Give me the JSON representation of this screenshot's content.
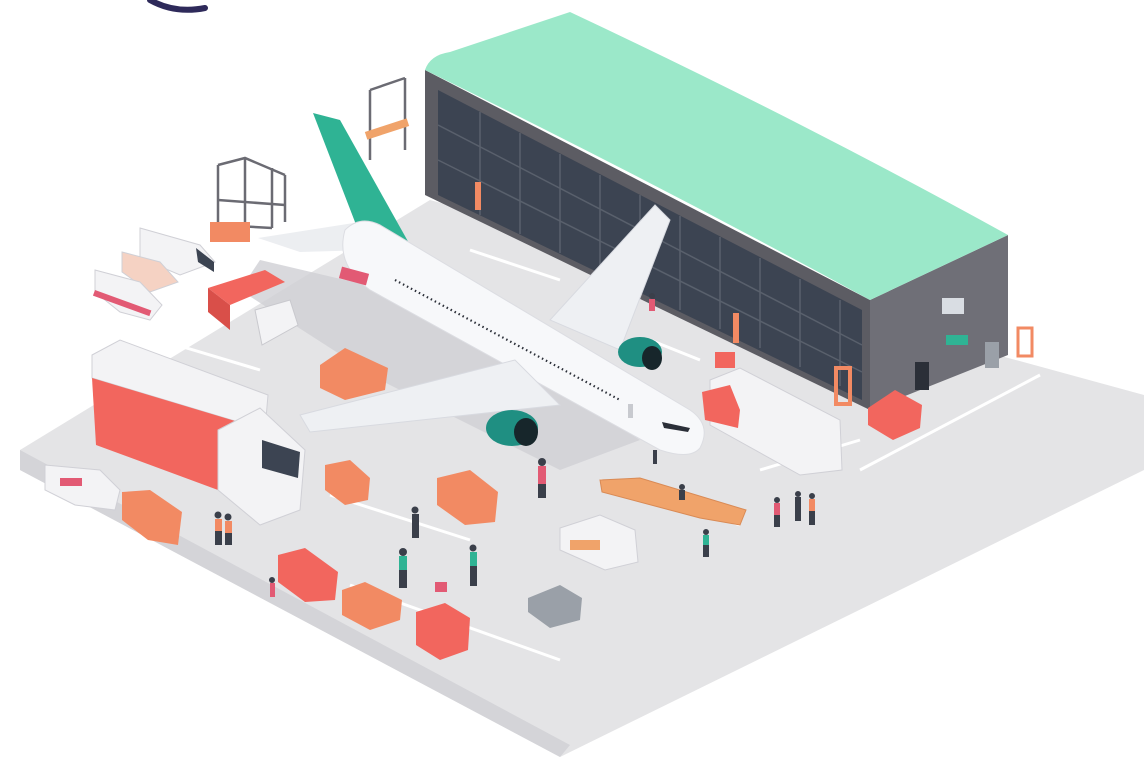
{
  "scene": {
    "subject": "isometric-airport-cargo-apron",
    "colors": {
      "background": "#ffffff",
      "apron": "#e4e4e6",
      "apron_edge": "#d4d4d8",
      "lane_marking": "#ffffff",
      "hangar_roof": "#9be8c9",
      "hangar_wall": "#6f6f77",
      "hangar_glass": "#3c4452",
      "hangar_mullion": "#59606c",
      "aircraft_body": "#f7f8fa",
      "aircraft_shadow": "#c9c9ce",
      "tail_fin": "#2fb394",
      "engine": "#1f8f82",
      "cargo_red": "#f2665e",
      "cargo_orange": "#f28a63",
      "truck_white": "#f3f3f5",
      "ramp_orange": "#f0a36a",
      "crane_frame": "#6b6b73",
      "person_dark": "#3a3f4a"
    },
    "corner_arc_color": "#2e2a5a"
  }
}
